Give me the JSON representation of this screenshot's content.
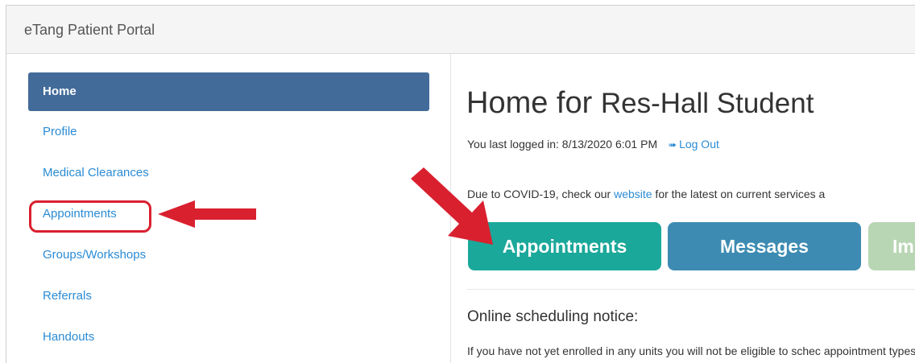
{
  "app": {
    "title": "eTang Patient Portal"
  },
  "sidebar": {
    "items": [
      {
        "label": "Home",
        "active": true
      },
      {
        "label": "Profile"
      },
      {
        "label": "Medical Clearances"
      },
      {
        "label": "Appointments"
      },
      {
        "label": "Groups/Workshops"
      },
      {
        "label": "Referrals"
      },
      {
        "label": "Handouts"
      }
    ]
  },
  "main": {
    "title_prefix": "Home for",
    "user_name": "Res-Hall Student",
    "last_login_label": "You last logged in: 8/13/2020 6:01 PM",
    "logout_label": "Log Out",
    "logout_icon": "sign-out-icon",
    "notice_before": "Due to COVID-19, check our ",
    "notice_link": "website",
    "notice_after": " for the latest on current services a",
    "tiles": [
      {
        "label": "Appointments",
        "color": "#1aa89a"
      },
      {
        "label": "Messages",
        "color": "#3d8bb2"
      },
      {
        "label": "Im",
        "color": "#b9d6b4"
      }
    ],
    "section_heading": "Online scheduling notice:",
    "section_body": "If you have not yet enrolled in any units you will not be eligible to schec appointment types"
  },
  "colors": {
    "active_nav": "#436b99",
    "link": "#2a8bd4",
    "annotation_red": "#d9202f"
  }
}
